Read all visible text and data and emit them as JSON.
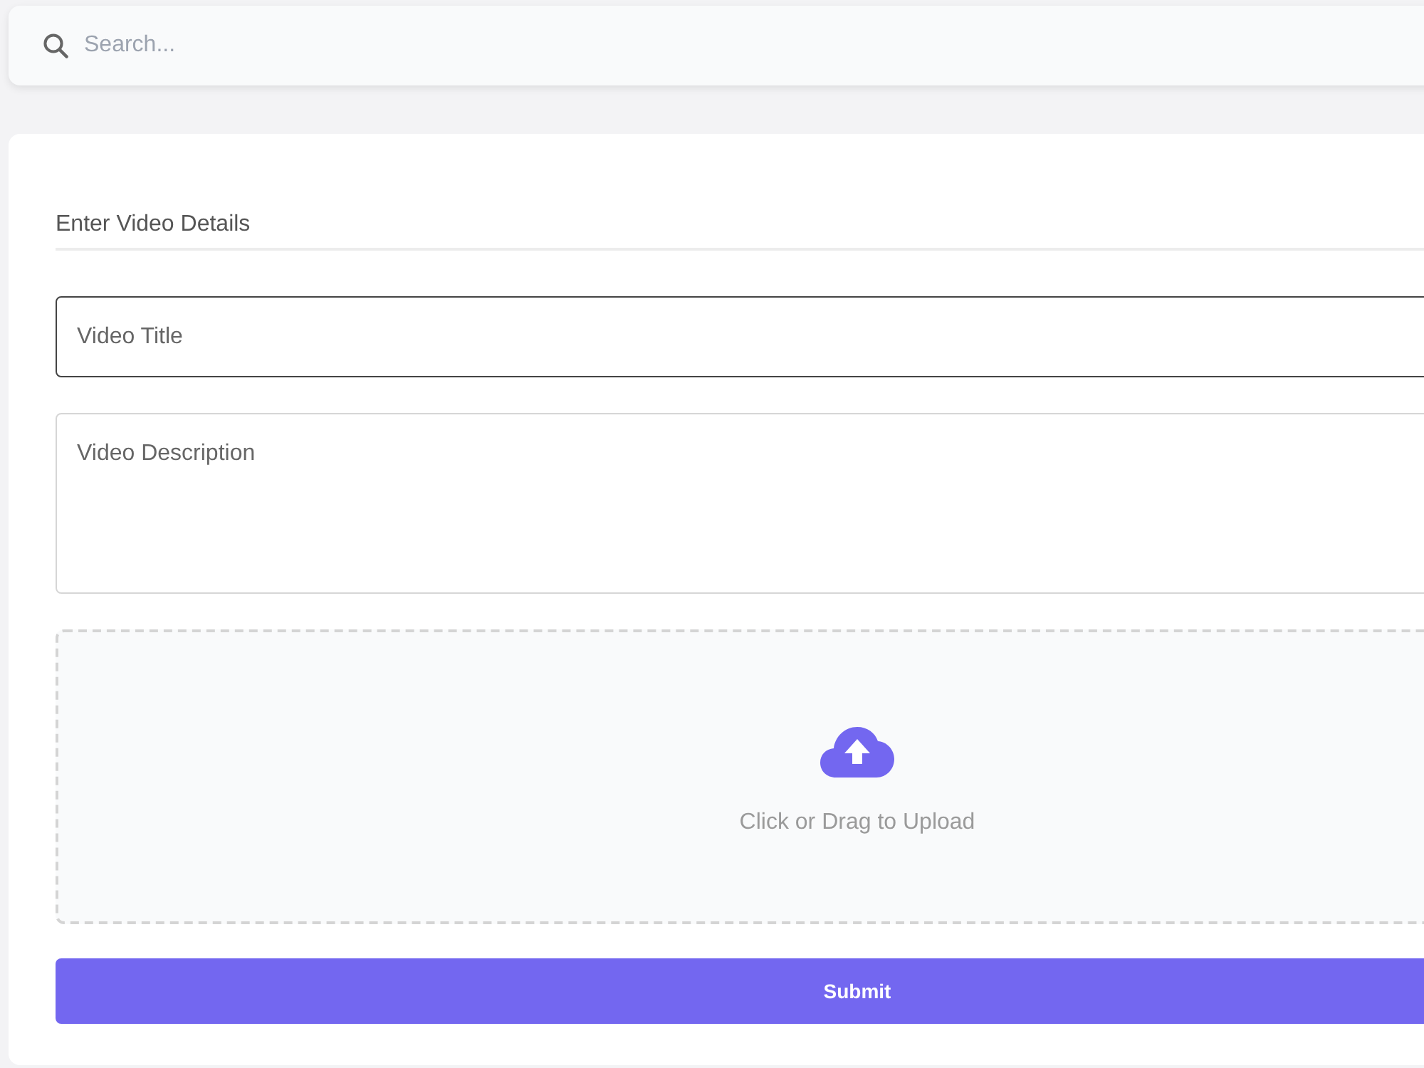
{
  "search": {
    "placeholder": "Search..."
  },
  "form": {
    "heading": "Enter Video Details",
    "fields": [
      {
        "kind": "input",
        "placeholder": "Video Title",
        "focused": true
      },
      {
        "kind": "textarea",
        "placeholder": "Video Description",
        "focused": false
      }
    ],
    "upload": {
      "label": "Click or Drag to Upload"
    },
    "submit": {
      "label": "Submit"
    }
  }
}
